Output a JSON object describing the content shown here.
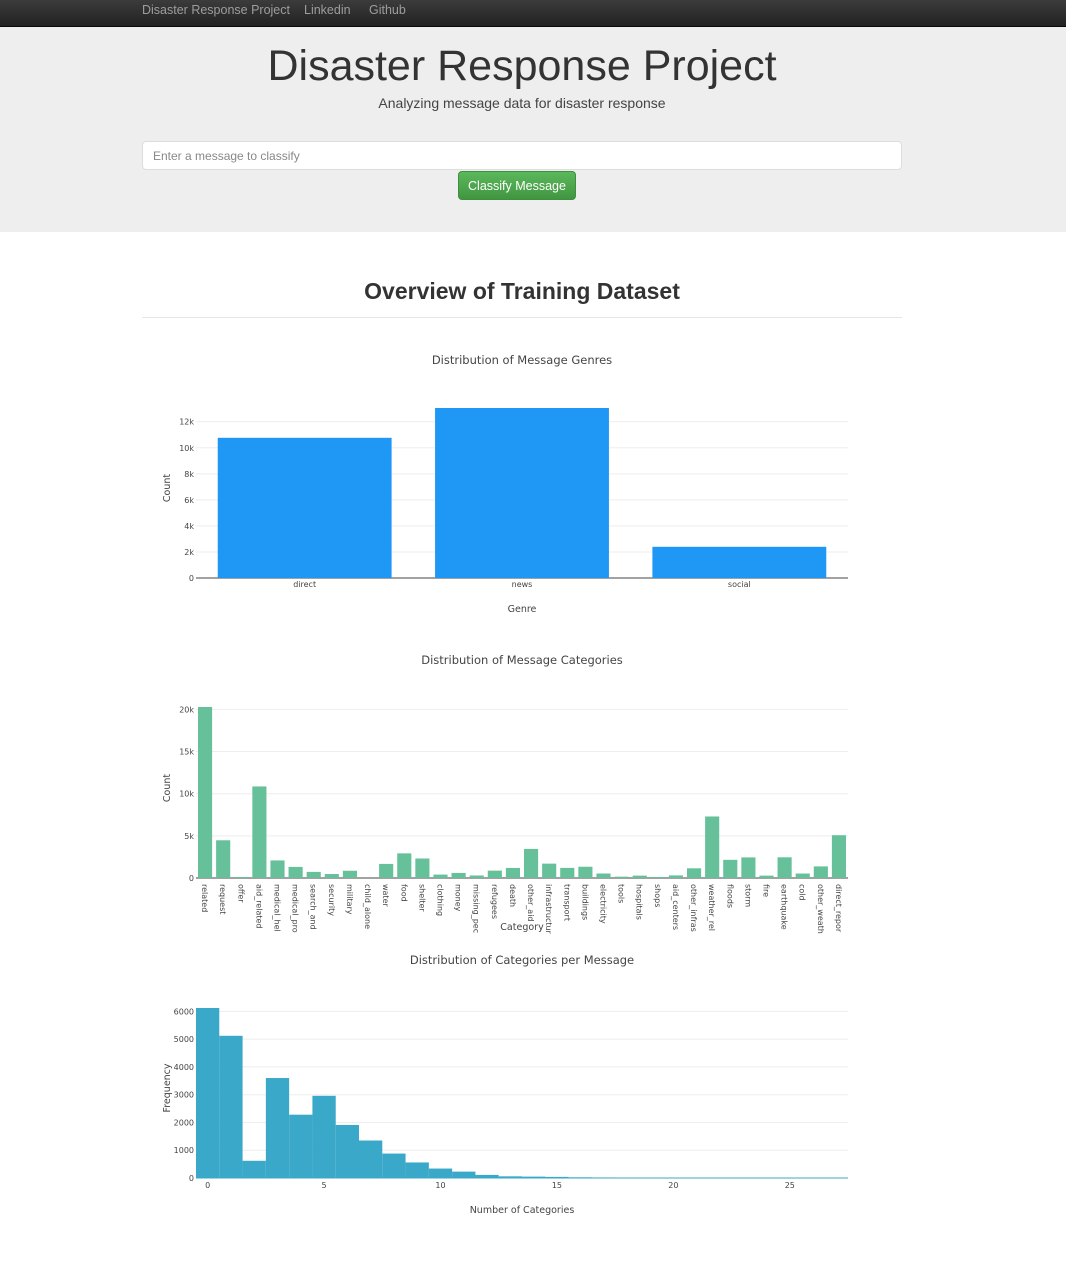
{
  "navbar": {
    "brand": "Disaster Response Project",
    "links": [
      "Linkedin",
      "Github"
    ]
  },
  "jumbotron": {
    "title": "Disaster Response Project",
    "subtitle": "Analyzing message data for disaster response",
    "input_placeholder": "Enter a message to classify",
    "input_value": "",
    "button_label": "Classify Message"
  },
  "overview": {
    "title": "Overview of Training Dataset"
  },
  "colors": {
    "genre_bar": "#1f97f4",
    "category_bar": "#66c19a",
    "histogram_bar": "#3aa8c8"
  },
  "chart_data": [
    {
      "type": "bar",
      "title": "Distribution of Message Genres",
      "xlabel": "Genre",
      "ylabel": "Count",
      "categories": [
        "direct",
        "news",
        "social"
      ],
      "values": [
        10766,
        13054,
        2396
      ],
      "ylim": [
        0,
        13054
      ],
      "yticks": [
        0,
        2000,
        4000,
        6000,
        8000,
        10000,
        12000
      ],
      "ytick_labels": [
        "0",
        "2k",
        "4k",
        "6k",
        "8k",
        "10k",
        "12k"
      ],
      "grid": true,
      "color": "#1f97f4"
    },
    {
      "type": "bar",
      "title": "Distribution of Message Categories",
      "xlabel": "Category",
      "ylabel": "Count",
      "categories": [
        "related",
        "request",
        "offer",
        "aid_related",
        "medical_hel",
        "medical_pro",
        "search_and",
        "security",
        "military",
        "child_alone",
        "water",
        "food",
        "shelter",
        "clothing",
        "money",
        "missing_pec",
        "refugees",
        "death",
        "other_aid",
        "infrastructur",
        "transport",
        "buildings",
        "electricity",
        "tools",
        "hospitals",
        "shops",
        "aid_centers",
        "other_infras",
        "weather_rel",
        "floods",
        "storm",
        "fire",
        "earthquake",
        "cold",
        "other_weath",
        "direct_repor"
      ],
      "values": [
        20282,
        4474,
        118,
        10860,
        2084,
        1313,
        724,
        471,
        860,
        0,
        1672,
        2923,
        2314,
        405,
        604,
        298,
        875,
        1194,
        3446,
        1705,
        1201,
        1333,
        532,
        159,
        283,
        120,
        309,
        1151,
        7297,
        2155,
        2443,
        282,
        2455,
        530,
        1376,
        5075
      ],
      "ylim": [
        0,
        20282
      ],
      "yticks": [
        0,
        5000,
        10000,
        15000,
        20000
      ],
      "ytick_labels": [
        "0",
        "5k",
        "10k",
        "15k",
        "20k"
      ],
      "grid": true,
      "color": "#66c19a"
    },
    {
      "type": "bar",
      "title": "Distribution of Categories per Message",
      "xlabel": "Number of Categories",
      "ylabel": "Frequency",
      "x": [
        0,
        1,
        2,
        3,
        4,
        5,
        6,
        7,
        8,
        9,
        10,
        11,
        12,
        13,
        14,
        15,
        16,
        17,
        18,
        19,
        20,
        21,
        22,
        23,
        24,
        25,
        26,
        27
      ],
      "values": [
        6122,
        5121,
        620,
        3600,
        2280,
        2960,
        1910,
        1350,
        880,
        560,
        340,
        230,
        110,
        60,
        50,
        40,
        25,
        20,
        15,
        12,
        10,
        8,
        6,
        5,
        4,
        3,
        2,
        1
      ],
      "xlim": [
        -0.5,
        27.5
      ],
      "ylim": [
        0,
        6122
      ],
      "xticks": [
        0,
        5,
        10,
        15,
        20,
        25
      ],
      "yticks": [
        0,
        1000,
        2000,
        3000,
        4000,
        5000,
        6000
      ],
      "grid": true,
      "color": "#3aa8c8"
    }
  ]
}
